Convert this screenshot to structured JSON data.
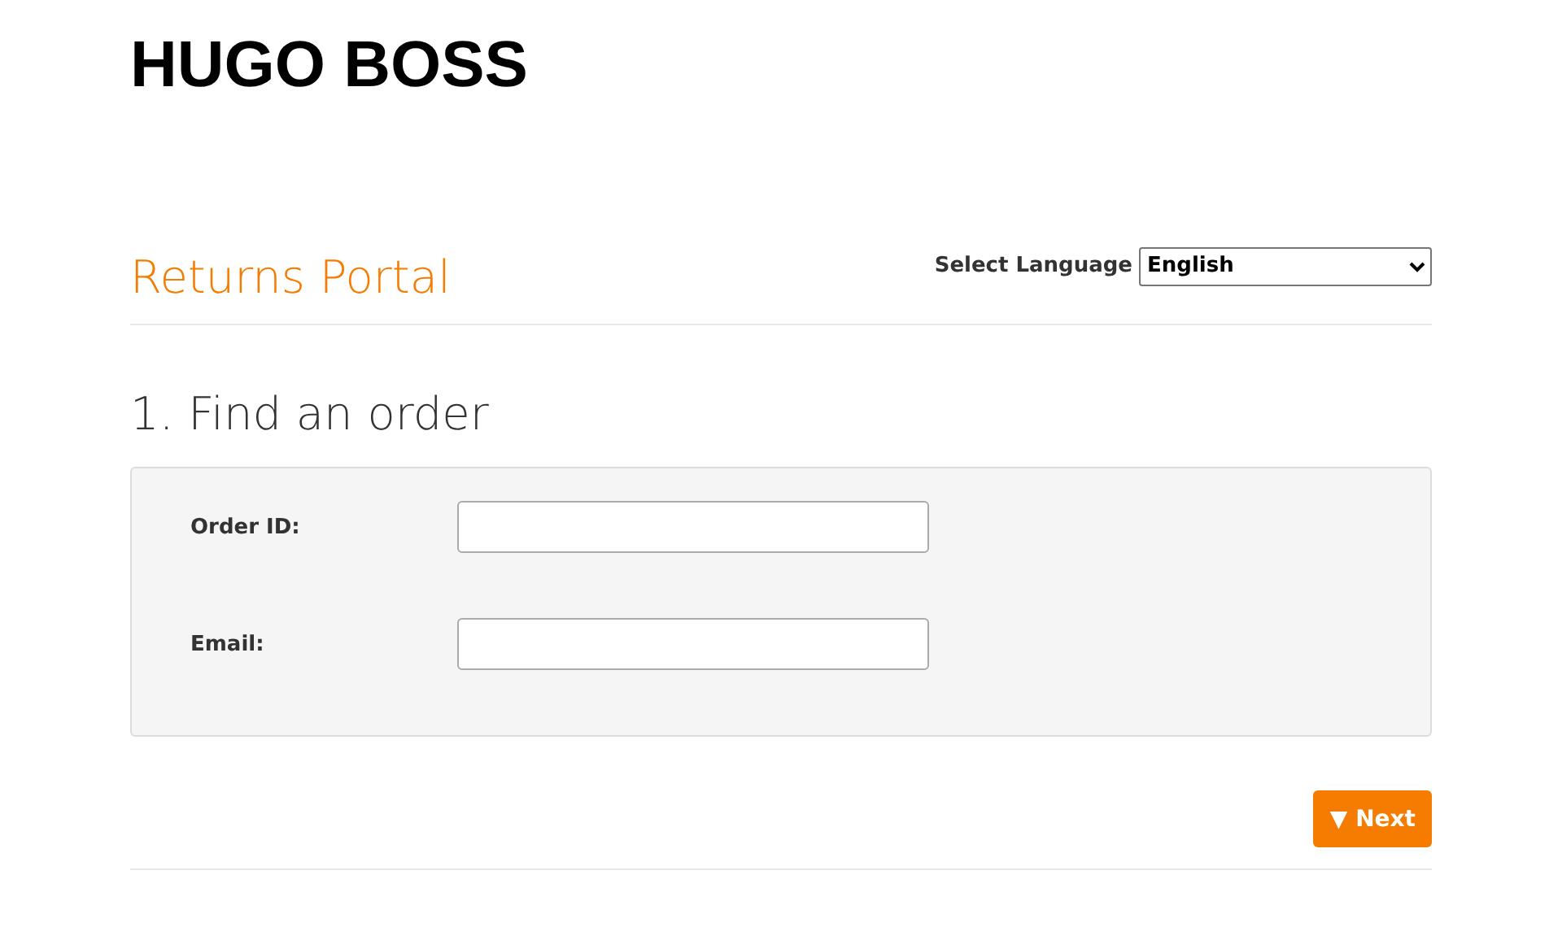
{
  "logo": "HUGO BOSS",
  "header": {
    "title": "Returns Portal",
    "language_label": "Select Language",
    "language_value": "English"
  },
  "section": {
    "heading": "1. Find an order",
    "fields": [
      {
        "label": "Order ID:"
      },
      {
        "label": "Email:"
      }
    ]
  },
  "button": {
    "label": "▼ Next"
  }
}
